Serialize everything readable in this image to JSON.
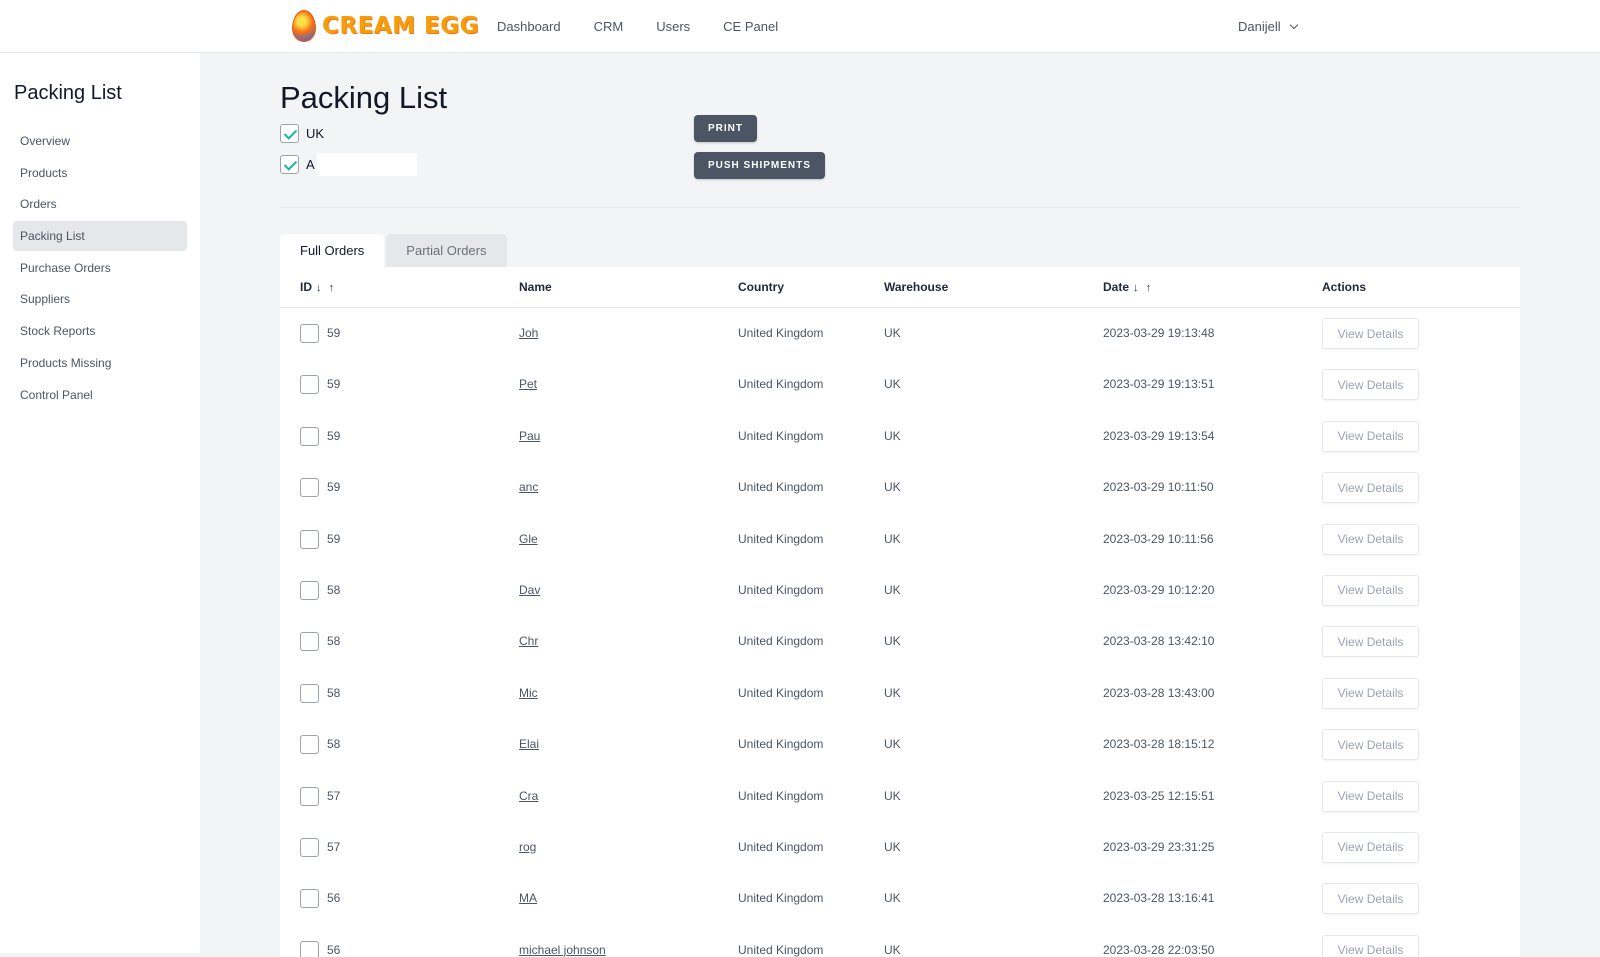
{
  "brand": {
    "name": "CREAM EGG"
  },
  "nav": {
    "links": [
      "Dashboard",
      "CRM",
      "Users",
      "CE Panel"
    ],
    "user": "Danijell"
  },
  "sidebar": {
    "title": "Packing List",
    "items": [
      "Overview",
      "Products",
      "Orders",
      "Packing List",
      "Purchase Orders",
      "Suppliers",
      "Stock Reports",
      "Products Missing",
      "Control Panel"
    ],
    "active_index": 3
  },
  "page": {
    "title": "Packing List",
    "regions": [
      {
        "label": "UK",
        "checked": true
      },
      {
        "label": "A",
        "checked": true
      }
    ],
    "print_label": "PRINT",
    "push_label": "PUSH SHIPMENTS"
  },
  "tabs": [
    "Full Orders",
    "Partial Orders"
  ],
  "table": {
    "headers": {
      "id": "ID",
      "id_sort": "↓ ↑",
      "name": "Name",
      "country": "Country",
      "warehouse": "Warehouse",
      "date": "Date",
      "date_sort": "↓ ↑",
      "actions": "Actions"
    },
    "action_label": "View Details",
    "rows": [
      {
        "id": "59",
        "name": "Joh",
        "country": "United Kingdom",
        "warehouse": "UK",
        "date": "2023-03-29 19:13:48"
      },
      {
        "id": "59",
        "name": "Pet",
        "country": "United Kingdom",
        "warehouse": "UK",
        "date": "2023-03-29 19:13:51"
      },
      {
        "id": "59",
        "name": "Pau",
        "country": "United Kingdom",
        "warehouse": "UK",
        "date": "2023-03-29 19:13:54"
      },
      {
        "id": "59",
        "name": "anc",
        "country": "United Kingdom",
        "warehouse": "UK",
        "date": "2023-03-29 10:11:50"
      },
      {
        "id": "59",
        "name": "Gle",
        "country": "United Kingdom",
        "warehouse": "UK",
        "date": "2023-03-29 10:11:56"
      },
      {
        "id": "58",
        "name": "Dav",
        "country": "United Kingdom",
        "warehouse": "UK",
        "date": "2023-03-29 10:12:20"
      },
      {
        "id": "58",
        "name": "Chr",
        "country": "United Kingdom",
        "warehouse": "UK",
        "date": "2023-03-28 13:42:10"
      },
      {
        "id": "58",
        "name": "Mic",
        "country": "United Kingdom",
        "warehouse": "UK",
        "date": "2023-03-28 13:43:00"
      },
      {
        "id": "58",
        "name": "Elai",
        "country": "United Kingdom",
        "warehouse": "UK",
        "date": "2023-03-28 18:15:12"
      },
      {
        "id": "57",
        "name": "Cra",
        "country": "United Kingdom",
        "warehouse": "UK",
        "date": "2023-03-25 12:15:51"
      },
      {
        "id": "57",
        "name": "rog",
        "country": "United Kingdom",
        "warehouse": "UK",
        "date": "2023-03-29 23:31:25"
      },
      {
        "id": "56",
        "name": "MA",
        "country": "United Kingdom",
        "warehouse": "UK",
        "date": "2023-03-28 13:16:41"
      },
      {
        "id": "56",
        "name": "michael johnson",
        "country": "United Kingdom",
        "warehouse": "UK",
        "date": "2023-03-28 22:03:50"
      }
    ]
  }
}
